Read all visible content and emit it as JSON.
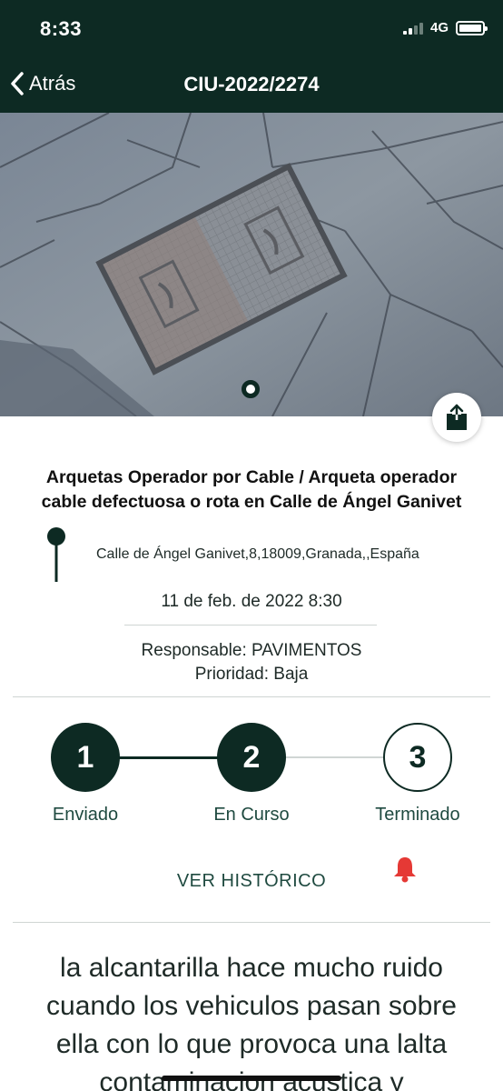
{
  "status_bar": {
    "time": "8:33",
    "network": "4G"
  },
  "nav": {
    "back_label": "Atrás",
    "title": "CIU-2022/2274"
  },
  "incident": {
    "title_line1": "Arquetas Operador por Cable / Arqueta operador",
    "title_line2": "cable defectuosa o rota en Calle de Ángel Ganivet",
    "address": "Calle de Ángel Ganivet,8,18009,Granada,,España",
    "date": "11 de feb. de 2022 8:30",
    "responsable": "Responsable: PAVIMENTOS",
    "prioridad": "Prioridad: Baja"
  },
  "progress": {
    "steps": [
      {
        "number": "1",
        "label": "Enviado",
        "state": "done"
      },
      {
        "number": "2",
        "label": "En Curso",
        "state": "done"
      },
      {
        "number": "3",
        "label": "Terminado",
        "state": "todo"
      }
    ]
  },
  "actions": {
    "historico": "VER HISTÓRICO"
  },
  "description": {
    "line1": "la alcantarilla hace mucho ruido",
    "line2": "cuando los vehiculos pasan sobre",
    "line3": "ella con lo que provoca una lalta",
    "line4": "contaminacion acustica y"
  },
  "colors": {
    "primary": "#0d2a23",
    "accent": "#1f4a40",
    "bell": "#e53935"
  },
  "icons": [
    "chevron-left-icon",
    "share-icon",
    "map-pin-icon",
    "bell-icon"
  ]
}
